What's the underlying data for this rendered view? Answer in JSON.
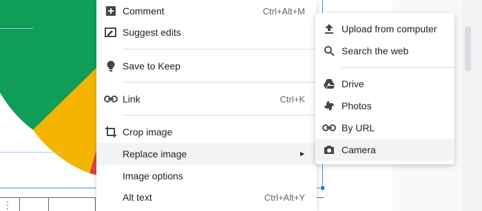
{
  "context_menu": {
    "items": [
      {
        "label": "Comment",
        "shortcut": "Ctrl+Alt+M",
        "icon": "comment-icon"
      },
      {
        "label": "Suggest edits",
        "shortcut": "",
        "icon": "suggest-edits-icon"
      },
      {
        "label": "Save to Keep",
        "shortcut": "",
        "icon": "keep-bulb-icon"
      },
      {
        "label": "Link",
        "shortcut": "Ctrl+K",
        "icon": "link-icon"
      },
      {
        "label": "Crop image",
        "shortcut": "",
        "icon": "crop-icon"
      },
      {
        "label": "Replace image",
        "shortcut": "",
        "icon": "",
        "submenu_arrow": "►"
      },
      {
        "label": "Image options",
        "shortcut": "",
        "icon": ""
      },
      {
        "label": "Alt text",
        "shortcut": "Ctrl+Alt+Y",
        "icon": ""
      }
    ],
    "active_item": "Replace image"
  },
  "replace_submenu": {
    "items": [
      {
        "label": "Upload from computer",
        "icon": "upload-icon"
      },
      {
        "label": "Search the web",
        "icon": "search-icon"
      },
      {
        "label": "Drive",
        "icon": "drive-icon"
      },
      {
        "label": "Photos",
        "icon": "photos-pinwheel-icon"
      },
      {
        "label": "By URL",
        "icon": "link-icon"
      },
      {
        "label": "Camera",
        "icon": "camera-icon"
      }
    ],
    "active_item": "Camera"
  },
  "colors": {
    "pie_green": "#0f9d58",
    "pie_yellow": "#f4b400",
    "pie_red": "#db4437",
    "selection_blue": "#1a73e8",
    "icon_gray": "#444746"
  }
}
